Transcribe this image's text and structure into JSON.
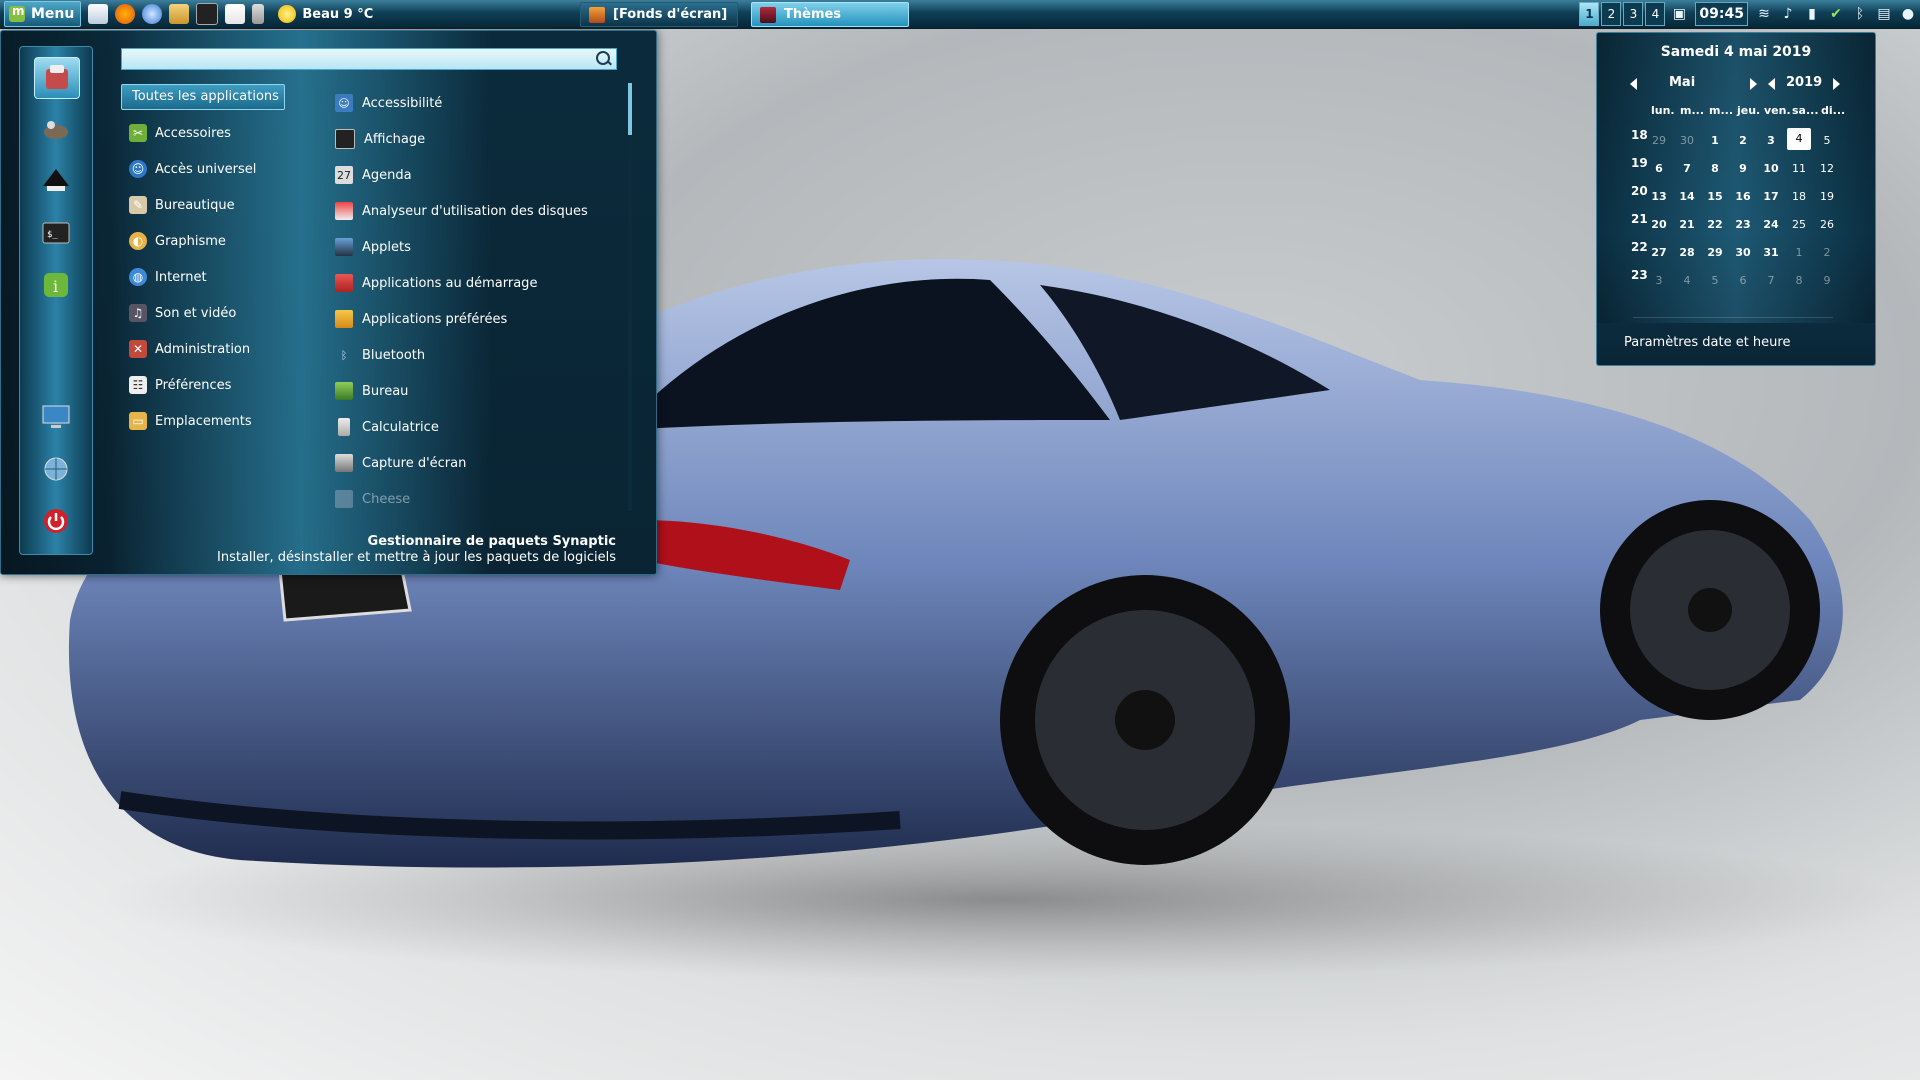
{
  "panel": {
    "menu_label": "Menu",
    "weather": "Beau 9 °C",
    "tasks": [
      {
        "label": "[Fonds d'écran]"
      },
      {
        "label": "Thèmes"
      }
    ],
    "workspaces": [
      "1",
      "2",
      "3",
      "4"
    ],
    "clock": "09:45"
  },
  "menu": {
    "search": {
      "value": "",
      "placeholder": ""
    },
    "categories": [
      {
        "label": "Toutes les applications",
        "icon": "all-icon"
      },
      {
        "label": "Accessoires",
        "icon": "accessories-icon"
      },
      {
        "label": "Accès universel",
        "icon": "universal-access-icon"
      },
      {
        "label": "Bureautique",
        "icon": "office-icon"
      },
      {
        "label": "Graphisme",
        "icon": "graphics-icon"
      },
      {
        "label": "Internet",
        "icon": "internet-icon"
      },
      {
        "label": "Son et vidéo",
        "icon": "sound-video-icon"
      },
      {
        "label": "Administration",
        "icon": "administration-icon"
      },
      {
        "label": "Préférences",
        "icon": "preferences-icon"
      },
      {
        "label": "Emplacements",
        "icon": "folder-icon"
      }
    ],
    "apps": [
      {
        "label": "Accessibilité",
        "icon": "accessibility-icon"
      },
      {
        "label": "Affichage",
        "icon": "display-icon"
      },
      {
        "label": "Agenda",
        "icon": "calendar-icon"
      },
      {
        "label": "Analyseur d'utilisation des disques",
        "icon": "disk-usage-icon"
      },
      {
        "label": "Applets",
        "icon": "applets-icon"
      },
      {
        "label": "Applications au démarrage",
        "icon": "startup-icon"
      },
      {
        "label": "Applications préférées",
        "icon": "preferred-apps-icon"
      },
      {
        "label": "Bluetooth",
        "icon": "bluetooth-icon"
      },
      {
        "label": "Bureau",
        "icon": "desktop-icon"
      },
      {
        "label": "Calculatrice",
        "icon": "calculator-icon"
      },
      {
        "label": "Capture d'écran",
        "icon": "screenshot-icon"
      },
      {
        "label": "Cheese",
        "icon": "cheese-icon"
      }
    ],
    "description_title": "Gestionnaire de paquets Synaptic",
    "description_text": "Installer, désinstaller et mettre à jour les paquets de logiciels"
  },
  "calendar": {
    "date_label": "Samedi 4 mai 2019",
    "month": "Mai",
    "year": "2019",
    "weekdays": [
      "lun.",
      "m...",
      "m...",
      "jeu.",
      "ven.",
      "sa...",
      "di..."
    ],
    "weeks": [
      {
        "num": "18",
        "days": [
          "29",
          "30",
          "1",
          "2",
          "3",
          "4",
          "5"
        ]
      },
      {
        "num": "19",
        "days": [
          "6",
          "7",
          "8",
          "9",
          "10",
          "11",
          "12"
        ]
      },
      {
        "num": "20",
        "days": [
          "13",
          "14",
          "15",
          "16",
          "17",
          "18",
          "19"
        ]
      },
      {
        "num": "21",
        "days": [
          "20",
          "21",
          "22",
          "23",
          "24",
          "25",
          "26"
        ]
      },
      {
        "num": "22",
        "days": [
          "27",
          "28",
          "29",
          "30",
          "31",
          "1",
          "2"
        ]
      },
      {
        "num": "23",
        "days": [
          "3",
          "4",
          "5",
          "6",
          "7",
          "8",
          "9"
        ]
      }
    ],
    "today": "4",
    "settings_link": "Paramètres date et heure"
  },
  "colors": {
    "accent": "#4aaed2",
    "panel_dark": "#062636"
  }
}
